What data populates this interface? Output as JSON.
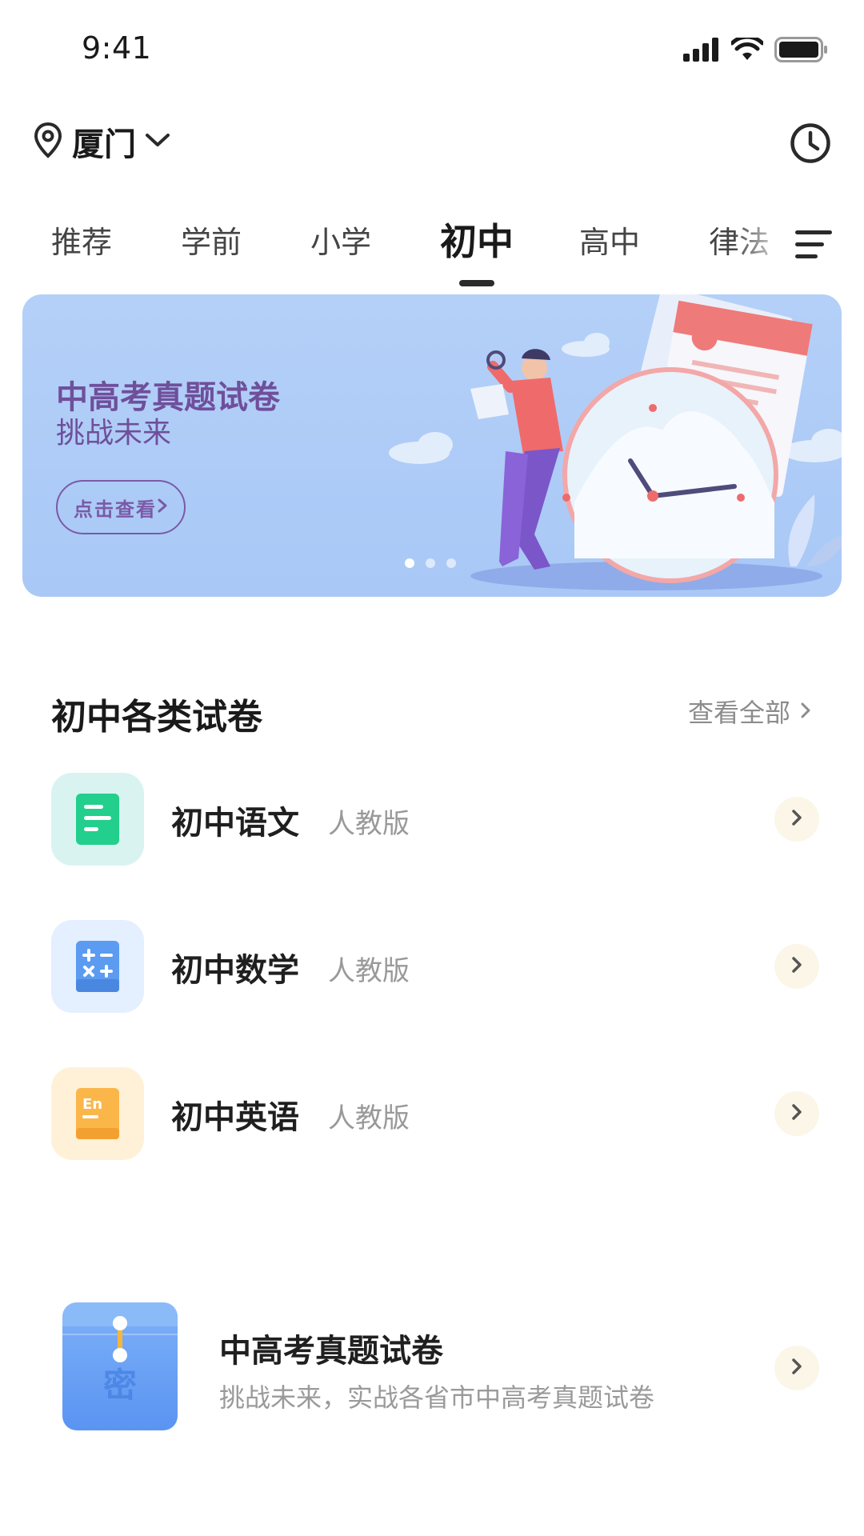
{
  "status_bar": {
    "time": "9:41"
  },
  "header": {
    "city": "厦门"
  },
  "tabs": [
    {
      "label": "推荐"
    },
    {
      "label": "学前"
    },
    {
      "label": "小学"
    },
    {
      "label": "初中",
      "active": true
    },
    {
      "label": "高中"
    },
    {
      "label": "律法"
    }
  ],
  "banner": {
    "title": "中高考真题试卷",
    "subtitle": "挑战未来",
    "button": "点击查看",
    "page_count": 3,
    "active_page": 1,
    "bg_color": "#aac9f6",
    "text_color": "#6f4f9b"
  },
  "section": {
    "title": "初中各类试卷",
    "see_all": "查看全部"
  },
  "subjects": [
    {
      "name": "初中语文",
      "edition": "人教版",
      "icon": "document-icon",
      "color": "#2fcf8f"
    },
    {
      "name": "初中数学",
      "edition": "人教版",
      "icon": "calculator-icon",
      "color": "#5b9bf2"
    },
    {
      "name": "初中英语",
      "edition": "人教版",
      "icon": "english-book-icon",
      "color": "#fbb64a",
      "icon_text": "En"
    }
  ],
  "promo": {
    "title": "中高考真题试卷",
    "description": "挑战未来，实战各省市中高考真题试卷",
    "icon_text": "密"
  }
}
